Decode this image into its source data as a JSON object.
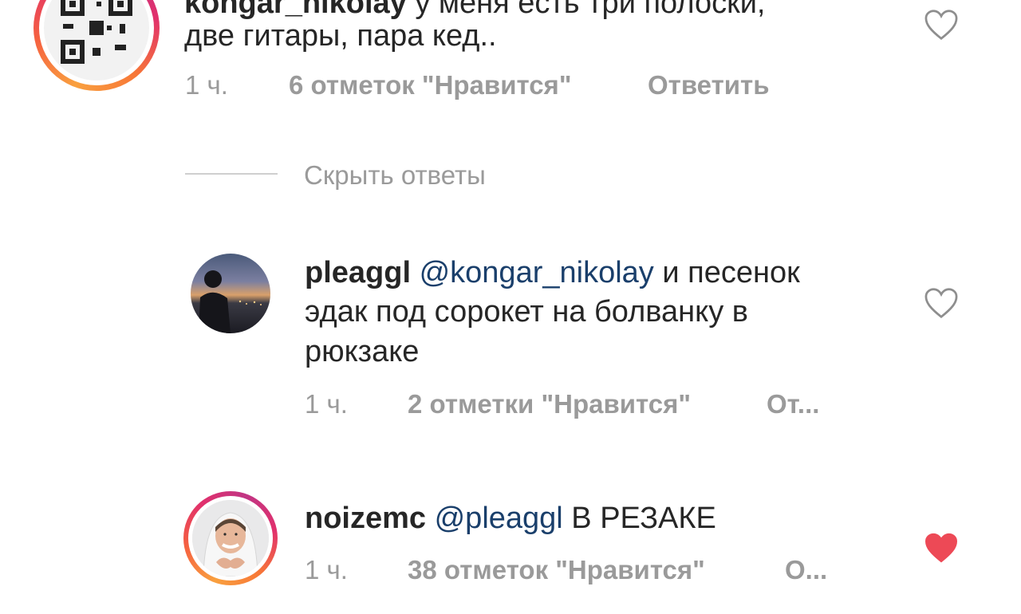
{
  "comments": [
    {
      "username": "kongar_nikolay",
      "text_line1_rest": " у меня есть три полоски,",
      "text_line2": "две гитары, пара кед..",
      "time": "1 ч.",
      "likes": "6 отметок \"Нравится\"",
      "reply": "Ответить",
      "liked": false
    },
    {
      "username": "pleaggl",
      "mention": "@kongar_nikolay",
      "text_line1_rest": " и песенок",
      "text_line2": "эдак под сорокет на болванку в",
      "text_line3": "рюкзаке",
      "time": "1 ч.",
      "likes": "2 отметки \"Нравится\"",
      "reply": "От...",
      "liked": false
    },
    {
      "username": "noizemc",
      "mention": "@pleaggl",
      "text_rest": " В РЕЗАКЕ",
      "time": "1 ч.",
      "likes": "38 отметок \"Нравится\"",
      "reply": "О...",
      "liked": true
    }
  ],
  "hide_replies": "Скрыть ответы",
  "colors": {
    "heart_liked": "#ed4956",
    "heart_outline": "#8e8e8e",
    "mention": "#1a3f6b",
    "meta": "#9a9a9a"
  }
}
